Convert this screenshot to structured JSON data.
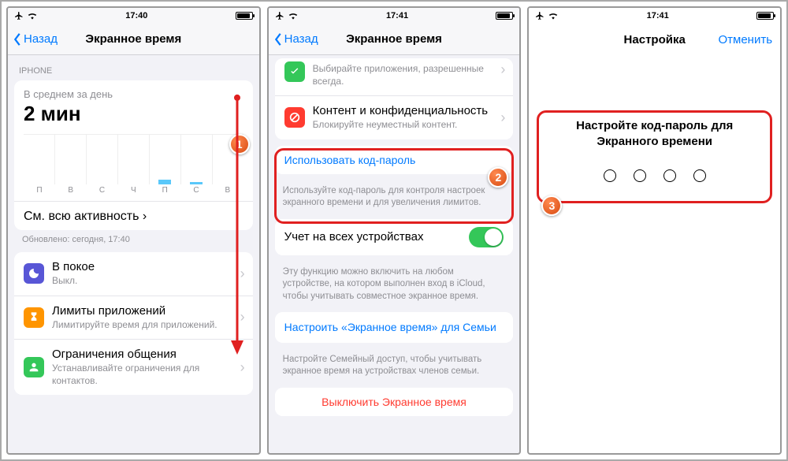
{
  "statusbar": {
    "time1": "17:40",
    "time2": "17:41",
    "time3": "17:41"
  },
  "nav": {
    "back": "Назад",
    "title": "Экранное время",
    "setup_title": "Настройка",
    "cancel": "Отменить"
  },
  "screen1": {
    "section": "IPHONE",
    "avg_label": "В среднем за день",
    "avg_value": "2 мин",
    "days": [
      "П",
      "В",
      "С",
      "Ч",
      "П",
      "С",
      "В"
    ],
    "see_all": "См. всю активность",
    "updated": "Обновлено: сегодня, 17:40",
    "downtime_title": "В покое",
    "downtime_sub": "Выкл.",
    "limits_title": "Лимиты приложений",
    "limits_sub": "Лимитируйте время для приложений.",
    "comm_title": "Ограничения общения",
    "comm_sub": "Устанавливайте ограничения для контактов."
  },
  "screen2": {
    "allowed_sub": "Выбирайте приложения, разрешенные всегда.",
    "content_title": "Контент и конфиденциальность",
    "content_sub": "Блокируйте неуместный контент.",
    "use_passcode": "Использовать код-пароль",
    "passcode_foot": "Используйте код-пароль для контроля настроек экранного времени и для увеличения лимитов.",
    "share_title": "Учет на всех устройствах",
    "share_foot": "Эту функцию можно включить на любом устройстве, на котором выполнен вход в iCloud, чтобы учитывать совместное экранное время.",
    "family": "Настроить «Экранное время» для Семьи",
    "family_foot": "Настройте Семейный доступ, чтобы учитывать экранное время на устройствах членов семьи.",
    "turn_off": "Выключить Экранное время"
  },
  "screen3": {
    "title_l1": "Настройте код-пароль для",
    "title_l2": "Экранного времени"
  },
  "steps": {
    "s1": "1",
    "s2": "2",
    "s3": "3"
  }
}
